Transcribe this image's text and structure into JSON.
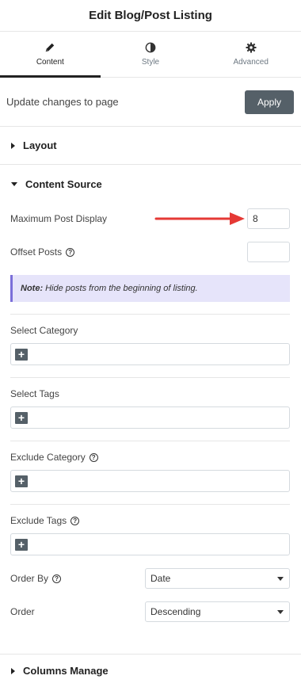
{
  "header": {
    "title": "Edit Blog/Post Listing"
  },
  "tabs": [
    {
      "label": "Content",
      "icon": "pencil-icon",
      "active": true
    },
    {
      "label": "Style",
      "icon": "contrast-icon",
      "active": false
    },
    {
      "label": "Advanced",
      "icon": "gear-icon",
      "active": false
    }
  ],
  "update": {
    "text": "Update changes to page",
    "button": "Apply"
  },
  "sections": {
    "layout": "Layout",
    "content_source": "Content Source",
    "columns_manage": "Columns Manage"
  },
  "fields": {
    "max_post_label": "Maximum Post Display",
    "max_post_value": "8",
    "offset_label": "Offset Posts",
    "offset_value": "",
    "note_bold": "Note:",
    "note_text": "Hide posts from the beginning of listing.",
    "select_category": "Select Category",
    "select_tags": "Select Tags",
    "exclude_category": "Exclude Category",
    "exclude_tags": "Exclude Tags",
    "order_by_label": "Order By",
    "order_by_value": "Date",
    "order_label": "Order",
    "order_value": "Descending",
    "help_glyph": "?",
    "plus_glyph": "+"
  },
  "colors": {
    "accent": "#556068",
    "note_bg": "#e6e4fa",
    "note_border": "#7b6fd9",
    "arrow": "#e53935"
  }
}
